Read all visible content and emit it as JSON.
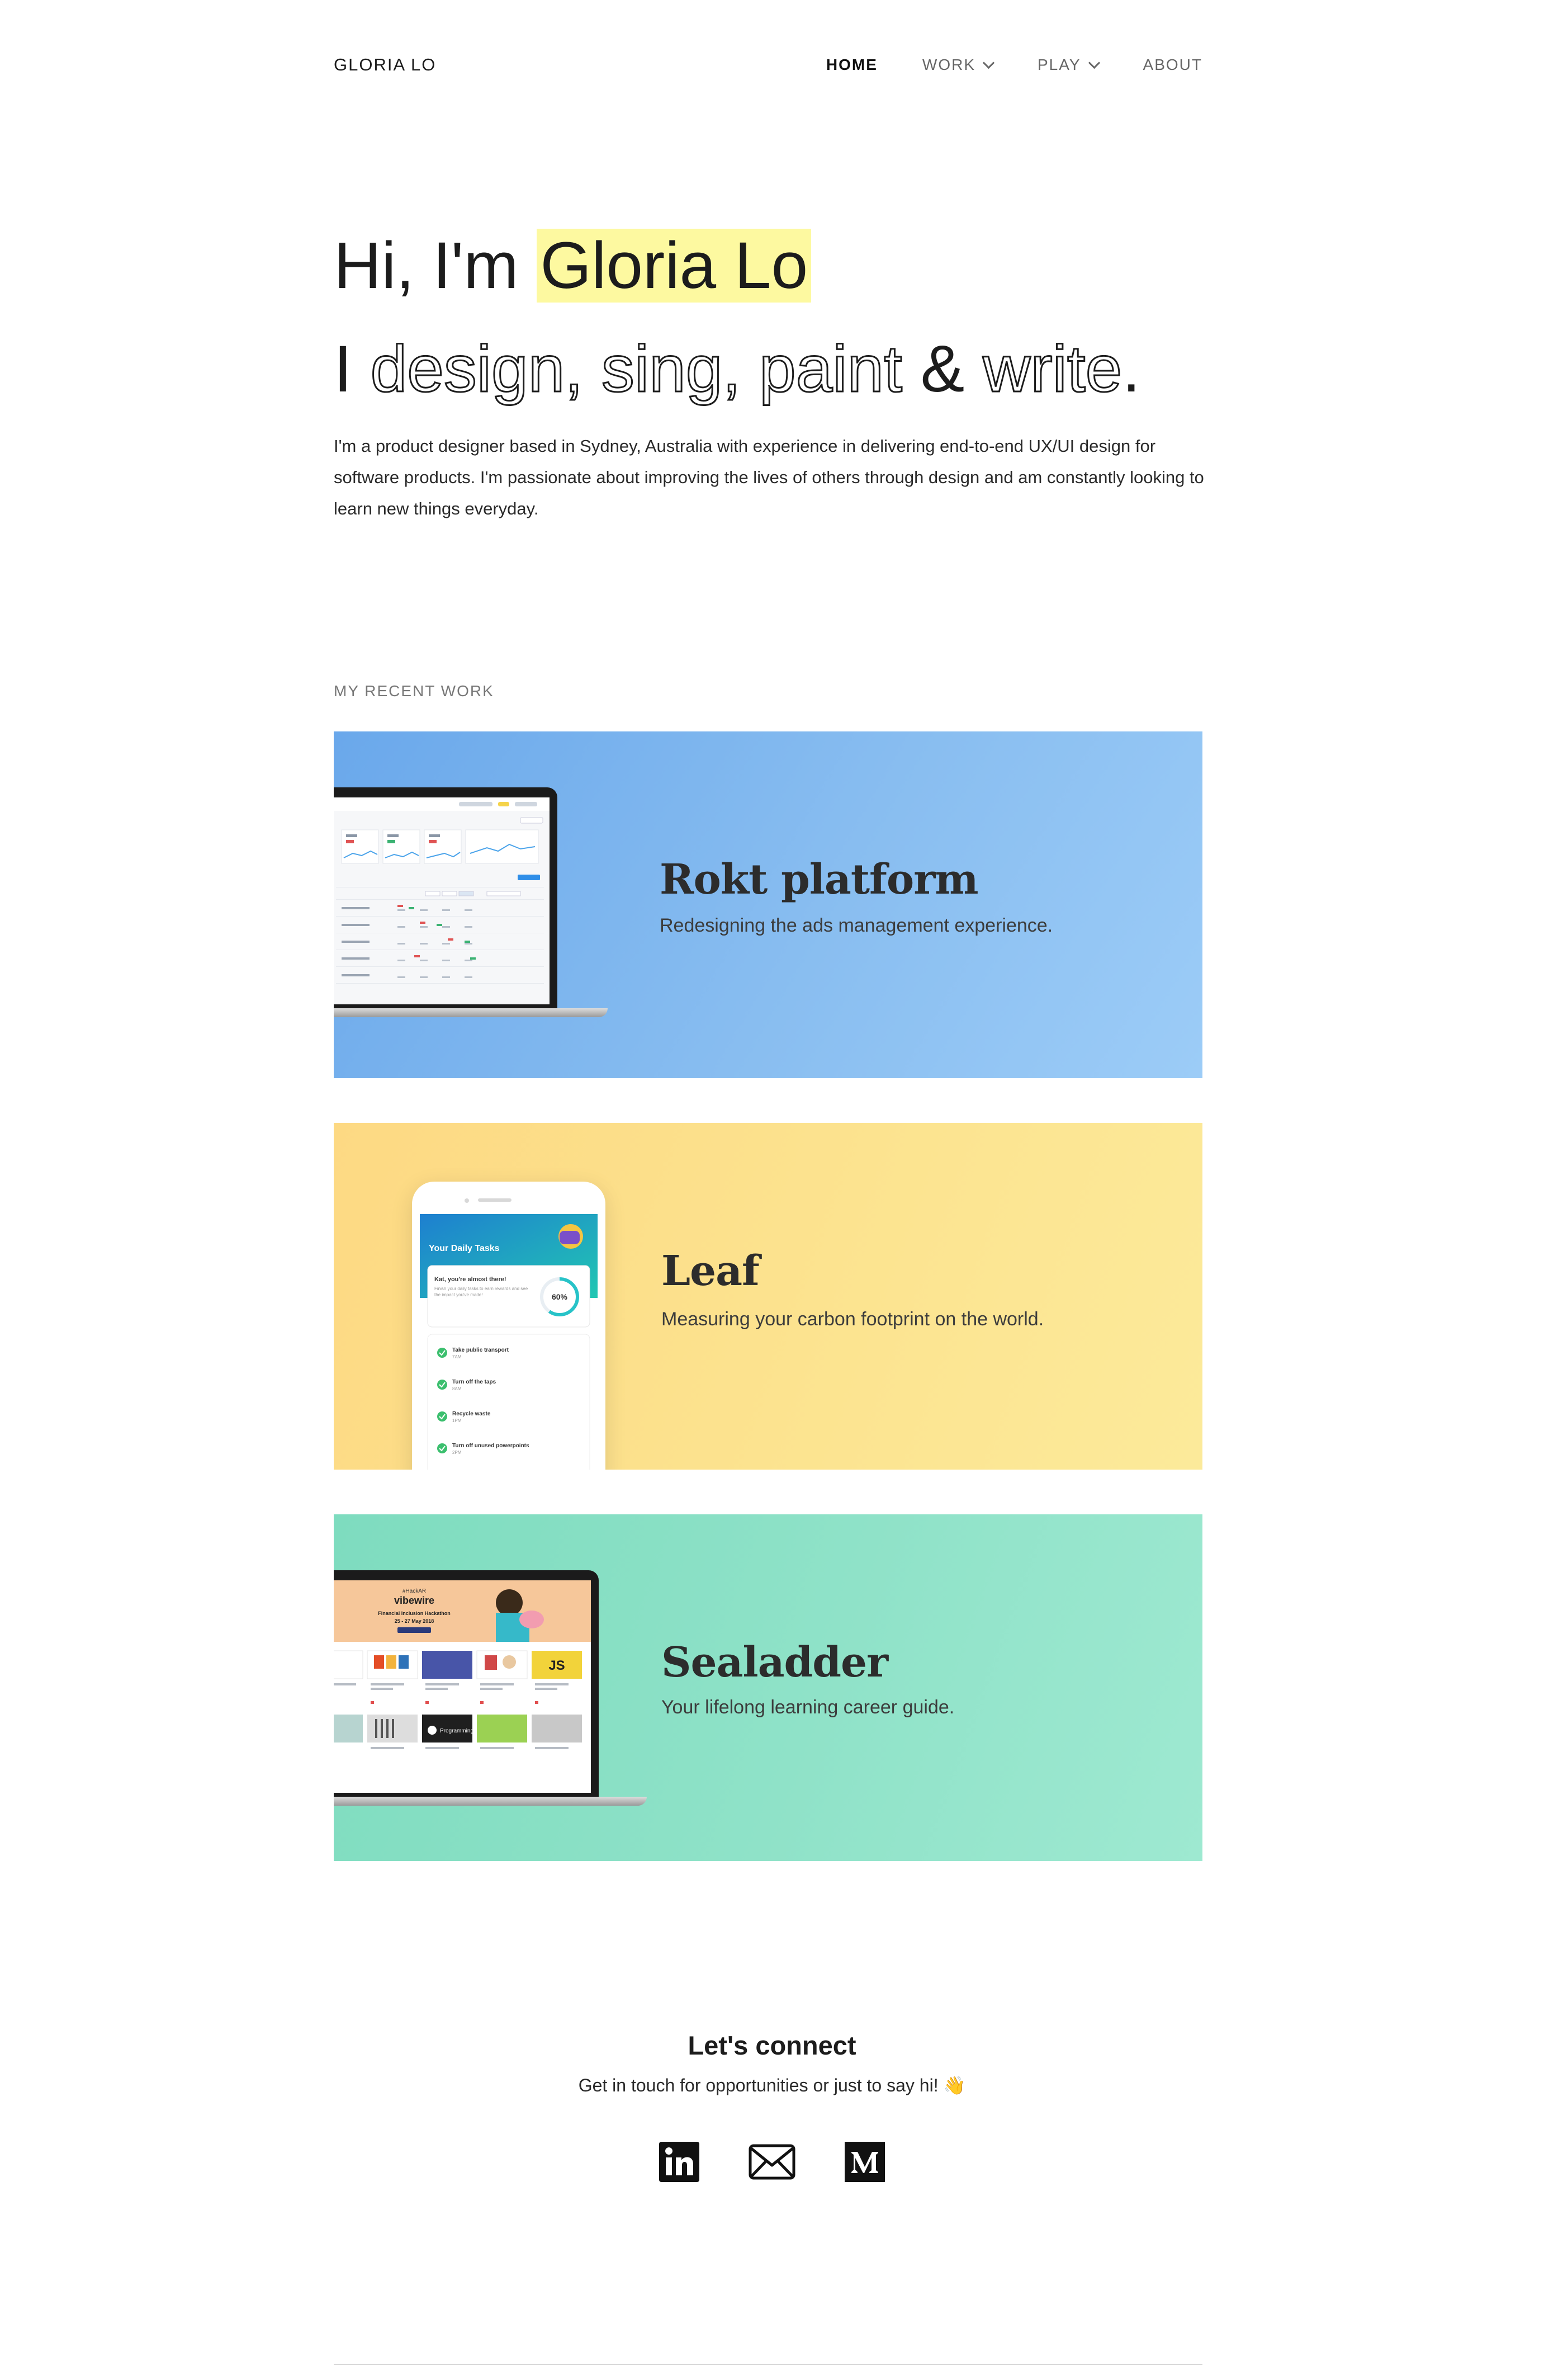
{
  "header": {
    "brand": "GLORIA LO",
    "nav": [
      {
        "label": "HOME",
        "active": true,
        "dropdown": false
      },
      {
        "label": "WORK",
        "active": false,
        "dropdown": true
      },
      {
        "label": "PLAY",
        "active": false,
        "dropdown": true
      },
      {
        "label": "ABOUT",
        "active": false,
        "dropdown": false
      }
    ]
  },
  "hero": {
    "greeting": "Hi, I'm",
    "name": "Gloria Lo",
    "line2_prefix": "I",
    "activity1": "design,",
    "activity2": "sing,",
    "activity3": "paint",
    "ampersand": "&",
    "activity4": "write",
    "period": ".",
    "description": "I'm a product designer based in Sydney, Australia with experience in delivering end-to-end UX/UI design for software products. I'm passionate about improving the lives of others through design and am constantly looking to learn new things everyday."
  },
  "work": {
    "section_label": "MY RECENT WORK",
    "projects": [
      {
        "title": "Rokt platform",
        "subtitle": "Redesigning the ads management experience."
      },
      {
        "title": "Leaf",
        "subtitle": "Measuring your carbon footprint on the world."
      },
      {
        "title": "Sealadder",
        "subtitle": "Your lifelong learning career guide."
      }
    ],
    "leaf_phone": {
      "header": "Your Daily Tasks",
      "card_title": "Kat, you're almost there!",
      "card_text": "Finish your daily tasks to earn rewards and see the impact you've made!",
      "progress": "60%",
      "tasks": [
        {
          "label": "Take public transport",
          "time": "7AM"
        },
        {
          "label": "Turn off the taps",
          "time": "8AM"
        },
        {
          "label": "Recycle waste",
          "time": "1PM"
        },
        {
          "label": "Turn off unused powerpoints",
          "time": "2PM"
        }
      ]
    },
    "sea_screen": {
      "banner_small": "#HackAR",
      "banner_brand": "vibewire",
      "banner_title": "Financial Inclusion Hackathon",
      "banner_date": "25 - 27 May 2018",
      "js_tile": "JS",
      "prog_tile": "Programming"
    }
  },
  "connect": {
    "title": "Let's connect",
    "subtitle": "Get in touch for opportunities or just to say hi! 👋"
  },
  "colors": {
    "highlight": "#fdf9a0",
    "rokt_bg": "#88bdf0",
    "leaf_bg": "#fce38f",
    "sea_bg": "#8fe2c8"
  },
  "icons": [
    "linkedin-icon",
    "mail-icon",
    "medium-icon"
  ]
}
